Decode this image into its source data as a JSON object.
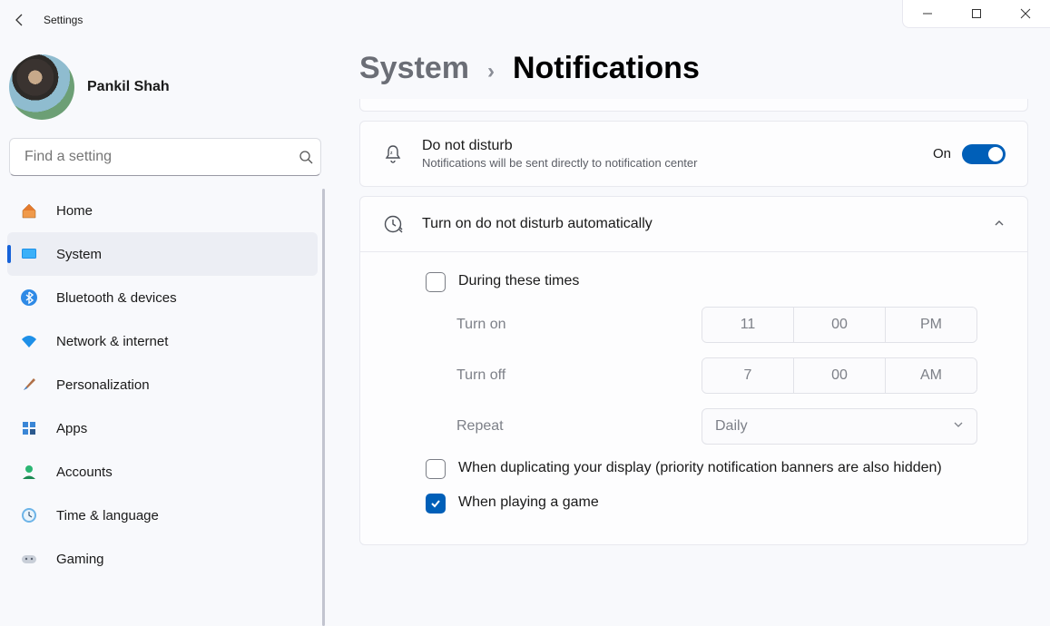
{
  "titlebar": {
    "title": "Settings"
  },
  "profile": {
    "name": "Pankil Shah"
  },
  "search": {
    "placeholder": "Find a setting"
  },
  "nav": [
    {
      "label": "Home"
    },
    {
      "label": "System"
    },
    {
      "label": "Bluetooth & devices"
    },
    {
      "label": "Network & internet"
    },
    {
      "label": "Personalization"
    },
    {
      "label": "Apps"
    },
    {
      "label": "Accounts"
    },
    {
      "label": "Time & language"
    },
    {
      "label": "Gaming"
    }
  ],
  "breadcrumb": {
    "parent": "System",
    "current": "Notifications",
    "sep": "›"
  },
  "dnd": {
    "title": "Do not disturb",
    "subtitle": "Notifications will be sent directly to notification center",
    "state_label": "On"
  },
  "auto": {
    "title": "Turn on do not disturb automatically",
    "opt_times": "During these times",
    "turn_on_lbl": "Turn on",
    "turn_on": {
      "h": "11",
      "m": "00",
      "ap": "PM"
    },
    "turn_off_lbl": "Turn off",
    "turn_off": {
      "h": "7",
      "m": "00",
      "ap": "AM"
    },
    "repeat_lbl": "Repeat",
    "repeat_value": "Daily",
    "opt_dup": "When duplicating your display (priority notification banners are also hidden)",
    "opt_game": "When playing a game"
  }
}
